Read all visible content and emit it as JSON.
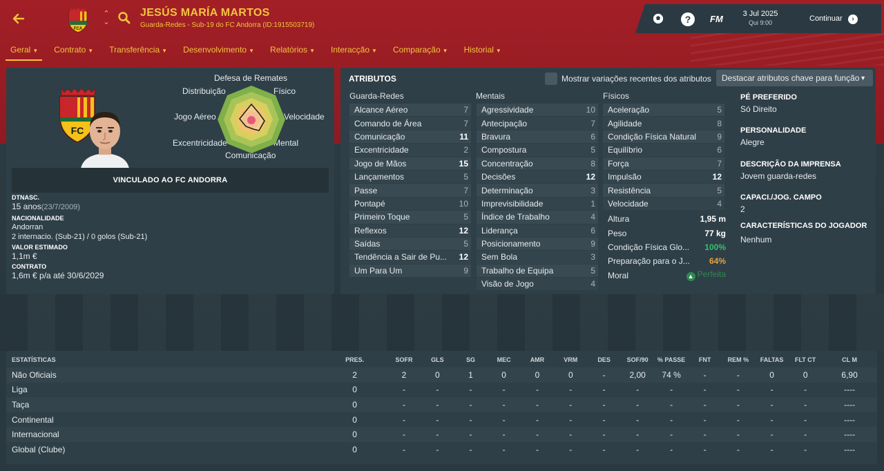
{
  "header": {
    "player_name": "JESÚS MARÍA MARTOS",
    "player_sub": "Guarda-Redes - Sub-19 do FC Andorra (ID:1915503719)",
    "date": "3 Jul 2025",
    "time": "Qui 9:00",
    "fm_label": "FM",
    "help_label": "?",
    "continue_label": "Continuar",
    "icons": [
      "back-arrow-icon",
      "club-crest-icon",
      "up-down-icon",
      "search-icon",
      "ball-icon",
      "help-icon",
      "continue-icon"
    ]
  },
  "nav": [
    {
      "label": "Geral",
      "active": true
    },
    {
      "label": "Contrato"
    },
    {
      "label": "Transferência"
    },
    {
      "label": "Desenvolvimento"
    },
    {
      "label": "Relatórios"
    },
    {
      "label": "Interacção"
    },
    {
      "label": "Comparação"
    },
    {
      "label": "Historial"
    }
  ],
  "radar": {
    "labels": {
      "top": "Defesa de Remates",
      "tl": "Distribuição",
      "tr": "Físico",
      "l": "Jogo Aéreo",
      "r": "Velocidade",
      "bl": "Excentricidade",
      "br": "Mental",
      "b": "Comunicação"
    }
  },
  "profile": {
    "contract_banner": "VINCULADO AO FC ANDORRA",
    "dob_label": "DTNASC.",
    "age": "15 anos",
    "dob": "(23/7/2009)",
    "nationality_label": "NACIONALIDADE",
    "nationality": "Andorran",
    "caps": "2 internacio. (Sub-21) / 0 golos (Sub-21)",
    "value_label": "VALOR ESTIMADO",
    "value": "1,1m €",
    "contract_label": "CONTRATO",
    "contract": "1,6m € p/a até 30/6/2029"
  },
  "attributes": {
    "title": "ATRIBUTOS",
    "show_changes_label": "Mostrar variações recentes dos atributos",
    "highlight_dropdown": "Destacar atributos chave para função",
    "gk_header": "Guarda-Redes",
    "mental_header": "Mentais",
    "physical_header": "Físicos",
    "goalkeeping": [
      {
        "name": "Alcance Aéreo",
        "value": "7",
        "hi": false
      },
      {
        "name": "Comando de Área",
        "value": "7",
        "hi": false
      },
      {
        "name": "Comunicação",
        "value": "11",
        "hi": true
      },
      {
        "name": "Excentricidade",
        "value": "2",
        "hi": false
      },
      {
        "name": "Jogo de Mãos",
        "value": "15",
        "hi": true
      },
      {
        "name": "Lançamentos",
        "value": "5",
        "hi": false
      },
      {
        "name": "Passe",
        "value": "7",
        "hi": false
      },
      {
        "name": "Pontapé",
        "value": "10",
        "hi": false
      },
      {
        "name": "Primeiro Toque",
        "value": "5",
        "hi": false
      },
      {
        "name": "Reflexos",
        "value": "12",
        "hi": true
      },
      {
        "name": "Saídas",
        "value": "5",
        "hi": false
      },
      {
        "name": "Tendência a Sair de Pu...",
        "value": "12",
        "hi": true
      },
      {
        "name": "Um Para Um",
        "value": "9",
        "hi": false
      }
    ],
    "mental": [
      {
        "name": "Agressividade",
        "value": "10",
        "hi": false
      },
      {
        "name": "Antecipação",
        "value": "7",
        "hi": false
      },
      {
        "name": "Bravura",
        "value": "6",
        "hi": false
      },
      {
        "name": "Compostura",
        "value": "5",
        "hi": false
      },
      {
        "name": "Concentração",
        "value": "8",
        "hi": false
      },
      {
        "name": "Decisões",
        "value": "12",
        "hi": true
      },
      {
        "name": "Determinação",
        "value": "3",
        "hi": false
      },
      {
        "name": "Imprevisibilidade",
        "value": "1",
        "hi": false
      },
      {
        "name": "Índice de Trabalho",
        "value": "4",
        "hi": false
      },
      {
        "name": "Liderança",
        "value": "6",
        "hi": false
      },
      {
        "name": "Posicionamento",
        "value": "9",
        "hi": false
      },
      {
        "name": "Sem Bola",
        "value": "3",
        "hi": false
      },
      {
        "name": "Trabalho de Equipa",
        "value": "5",
        "hi": false
      },
      {
        "name": "Visão de Jogo",
        "value": "4",
        "hi": false
      }
    ],
    "physical": [
      {
        "name": "Aceleração",
        "value": "5",
        "hi": false
      },
      {
        "name": "Agilidade",
        "value": "8",
        "hi": false
      },
      {
        "name": "Condição Física Natural",
        "value": "9",
        "hi": false
      },
      {
        "name": "Equilíbrio",
        "value": "6",
        "hi": false
      },
      {
        "name": "Força",
        "value": "7",
        "hi": false
      },
      {
        "name": "Impulsão",
        "value": "12",
        "hi": true
      },
      {
        "name": "Resistência",
        "value": "5",
        "hi": false
      },
      {
        "name": "Velocidade",
        "value": "4",
        "hi": false
      }
    ],
    "physical_extra": {
      "height_label": "Altura",
      "height": "1,95 m",
      "weight_label": "Peso",
      "weight": "77 kg",
      "fitness_label": "Condição Física Glo...",
      "fitness": "100%",
      "match_prep_label": "Preparação para o J...",
      "match_prep": "64%",
      "morale_label": "Moral",
      "morale": "Perfeita"
    },
    "right_info": {
      "foot_label": "PÉ PREFERIDO",
      "foot": "Só Direito",
      "personality_label": "PERSONALIDADE",
      "personality": "Alegre",
      "press_label": "DESCRIÇÃO DA IMPRENSA",
      "press": "Jovem guarda-redes",
      "apps_label": "CAPACI./JOG. CAMPO",
      "apps": "2",
      "traits_label": "CARACTERÍSTICAS DO JOGADOR",
      "traits": "Nenhum"
    }
  },
  "stats": {
    "headers": [
      "ESTATÍSTICAS",
      "PRES.",
      "SOFR",
      "GLS",
      "SG",
      "MEC",
      "AMR",
      "VRM",
      "DES",
      "SOF/90",
      "% PASSE",
      "FNT",
      "REM %",
      "FALTAS",
      "FLT CT",
      "CL M"
    ],
    "rows": [
      [
        "Não Oficiais",
        "2",
        "2",
        "0",
        "1",
        "0",
        "0",
        "0",
        "-",
        "2,00",
        "74 %",
        "-",
        "-",
        "0",
        "0",
        "6,90"
      ],
      [
        "Liga",
        "0",
        "-",
        "-",
        "-",
        "-",
        "-",
        "-",
        "-",
        "-",
        "-",
        "-",
        "-",
        "-",
        "-",
        "----"
      ],
      [
        "Taça",
        "0",
        "-",
        "-",
        "-",
        "-",
        "-",
        "-",
        "-",
        "-",
        "-",
        "-",
        "-",
        "-",
        "-",
        "----"
      ],
      [
        "Continental",
        "0",
        "-",
        "-",
        "-",
        "-",
        "-",
        "-",
        "-",
        "-",
        "-",
        "-",
        "-",
        "-",
        "-",
        "----"
      ],
      [
        "Internacional",
        "0",
        "-",
        "-",
        "-",
        "-",
        "-",
        "-",
        "-",
        "-",
        "-",
        "-",
        "-",
        "-",
        "-",
        "----"
      ],
      [
        "Global (Clube)",
        "0",
        "-",
        "-",
        "-",
        "-",
        "-",
        "-",
        "-",
        "-",
        "-",
        "-",
        "-",
        "-",
        "-",
        "----"
      ]
    ]
  },
  "colors": {
    "header_red": "#a31f26",
    "accent_yellow": "#f2c53d",
    "panel": "#2f3f47",
    "positive_green": "#34c06b",
    "warning_orange": "#e8a33b"
  }
}
